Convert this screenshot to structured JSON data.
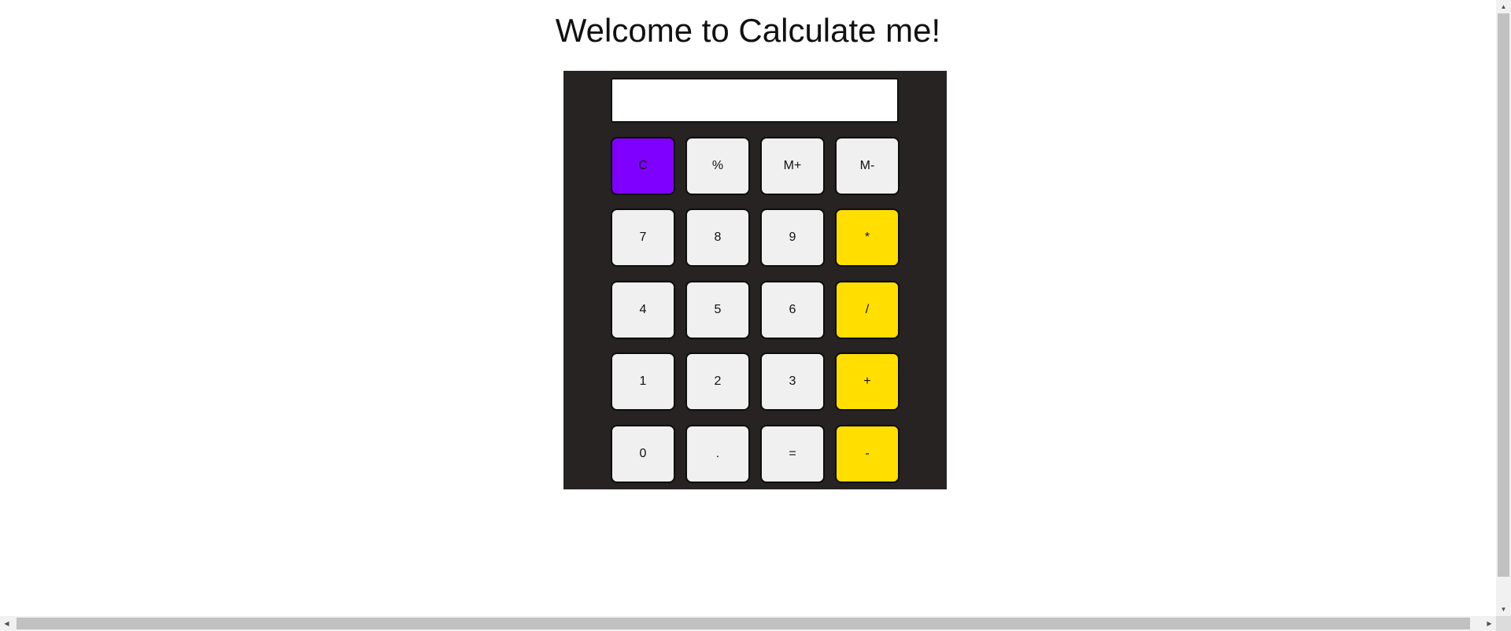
{
  "page": {
    "title": "Welcome to Calculate me!"
  },
  "calculator": {
    "display_value": "",
    "colors": {
      "body": "#262322",
      "key": "#f0f0f0",
      "clear_key": "#7f00ff",
      "operator_key": "#ffde00"
    },
    "rows": [
      [
        "C",
        "%",
        "M+",
        "M-"
      ],
      [
        "7",
        "8",
        "9",
        "*"
      ],
      [
        "4",
        "5",
        "6",
        "/"
      ],
      [
        "1",
        "2",
        "3",
        "+"
      ],
      [
        "0",
        ".",
        "=",
        "-"
      ]
    ]
  },
  "scrollbars": {
    "up_icon": "chevron-up-icon",
    "down_icon": "chevron-down-icon",
    "left_icon": "chevron-left-icon",
    "right_icon": "chevron-right-icon"
  }
}
